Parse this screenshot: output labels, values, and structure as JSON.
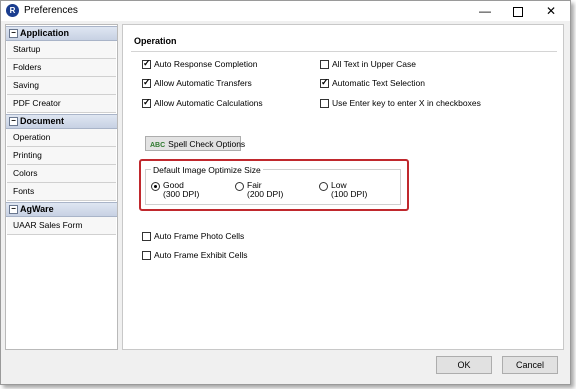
{
  "window": {
    "app_icon_letter": "R",
    "title": "Preferences",
    "minimize": "—",
    "close": "✕"
  },
  "sidebar": {
    "groups": [
      {
        "label": "Application",
        "items": [
          "Startup",
          "Folders",
          "Saving",
          "PDF Creator"
        ]
      },
      {
        "label": "Document",
        "items": [
          "Operation",
          "Printing",
          "Colors",
          "Fonts"
        ]
      },
      {
        "label": "AgWare",
        "items": [
          "UAAR Sales Form"
        ]
      }
    ],
    "collapse_glyph": "−"
  },
  "main": {
    "section_title": "Operation",
    "checkboxes": [
      {
        "label": "Auto Response Completion",
        "checked": true
      },
      {
        "label": "Allow Automatic Transfers",
        "checked": true
      },
      {
        "label": "Allow Automatic Calculations",
        "checked": true
      },
      {
        "label": "All Text in Upper Case",
        "checked": false
      },
      {
        "label": "Automatic Text Selection",
        "checked": true
      },
      {
        "label": "Use Enter key to enter X in checkboxes",
        "checked": false
      }
    ],
    "spell_check": {
      "icon_text": "ABC",
      "label": "Spell Check Options"
    },
    "image_size": {
      "legend": "Default Image Optimize Size",
      "options": [
        {
          "line1": "Good",
          "line2": "(300 DPI)",
          "selected": true
        },
        {
          "line1": "Fair",
          "line2": "(200 DPI)",
          "selected": false
        },
        {
          "line1": "Low",
          "line2": "(100 DPI)",
          "selected": false
        }
      ]
    },
    "frame_checkboxes": [
      {
        "label": "Auto Frame Photo Cells",
        "checked": false
      },
      {
        "label": "Auto Frame Exhibit Cells",
        "checked": false
      }
    ]
  },
  "footer": {
    "ok_label": "OK",
    "cancel_label": "Cancel"
  }
}
